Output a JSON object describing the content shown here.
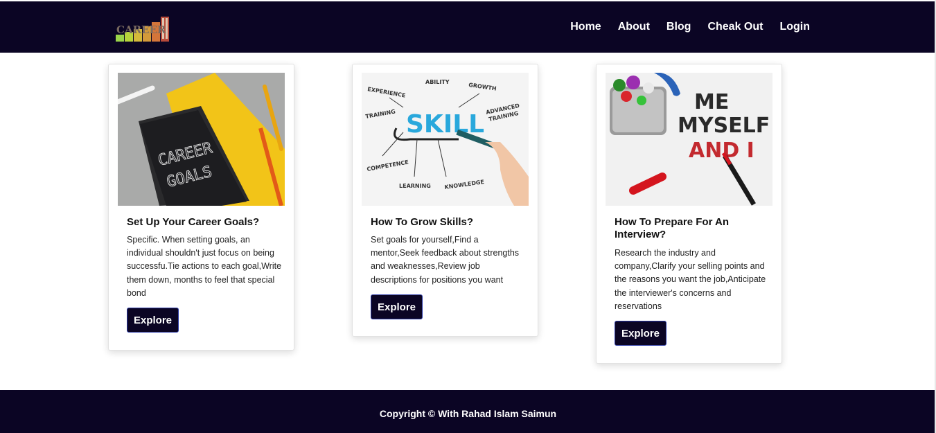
{
  "brand": {
    "logo_text": "CAREER",
    "colors": {
      "navbar": "#0b0524",
      "footer": "#0b0524",
      "button": "#0b0524"
    }
  },
  "nav": {
    "items": [
      "Home",
      "About",
      "Blog",
      "Cheak Out",
      "Login"
    ]
  },
  "cards": [
    {
      "title": "Set Up Your Career Goals?",
      "text": "Specific. When setting goals, an individual shouldn't just focus on being successfu.Tie actions to each goal,Write them down, months to feel that special bond",
      "button": "Explore",
      "image_words": [
        "CAREER",
        "GOALS"
      ]
    },
    {
      "title": "How To Grow Skills?",
      "text": "Set goals for yourself,Find a mentor,Seek feedback about strengths and weaknesses,Review job descriptions for positions you want",
      "button": "Explore",
      "image_words": [
        "SKILL",
        "EXPERIENCE",
        "ABILITY",
        "GROWTH",
        "TRAINING",
        "ADVANCED",
        "TRAINING",
        "COMPETENCE",
        "LEARNING",
        "KNOWLEDGE"
      ]
    },
    {
      "title": "How To Prepare For An Interview?",
      "text": "Research the industry and company,Clarify your selling points and the reasons you want the job,Anticipate the interviewer's concerns and reservations",
      "button": "Explore",
      "image_words": [
        "ME",
        "MYSELF",
        "AND I"
      ]
    }
  ],
  "footer": {
    "copyright": "Copyright © With Rahad Islam Saimun"
  }
}
